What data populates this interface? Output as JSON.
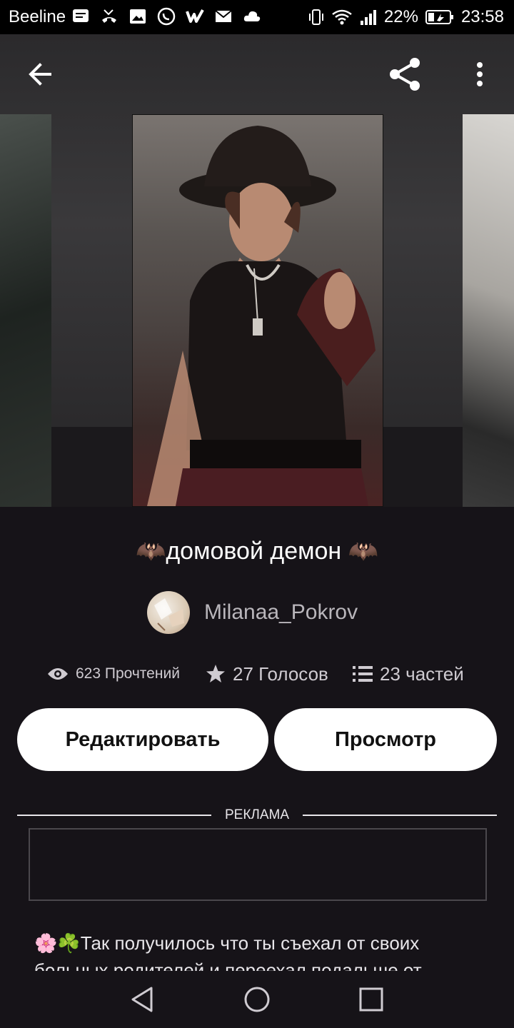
{
  "status_bar": {
    "carrier": "Beeline",
    "battery": "22%",
    "time": "23:58"
  },
  "story": {
    "title": "🦇домовой демон 🦇",
    "author": "Milanaa_Pokrov",
    "reads": "623 Прочтений",
    "votes": "27 Голосов",
    "parts": "23 частей",
    "description": "🌸☘️Так получилось что ты съехал от своих больных родителей и переехал подальше от"
  },
  "actions": {
    "edit_label": "Редактировать",
    "view_label": "Просмотр"
  },
  "ad": {
    "label": "РЕКЛАМА"
  },
  "icons": {
    "back": "arrow-left-icon",
    "share": "share-icon",
    "menu": "more-vertical-icon",
    "reads": "eye-icon",
    "votes": "star-icon",
    "parts": "list-icon"
  }
}
